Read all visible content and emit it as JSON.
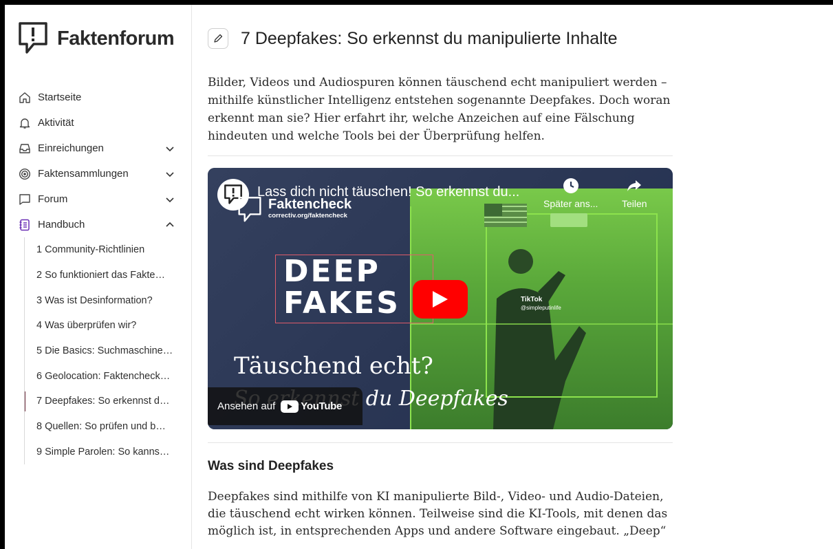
{
  "app": {
    "name": "Faktenforum"
  },
  "nav": {
    "items": [
      {
        "label": "Startseite",
        "icon": "home-icon",
        "expandable": false
      },
      {
        "label": "Aktivität",
        "icon": "bell-icon",
        "expandable": false
      },
      {
        "label": "Einreichungen",
        "icon": "inbox-icon",
        "expandable": true,
        "expanded": false
      },
      {
        "label": "Faktensammlungen",
        "icon": "target-icon",
        "expandable": true,
        "expanded": false
      },
      {
        "label": "Forum",
        "icon": "chat-bubble-icon",
        "expandable": true,
        "expanded": false
      },
      {
        "label": "Handbuch",
        "icon": "handbook-icon",
        "expandable": true,
        "expanded": true
      }
    ],
    "handbook_items": [
      "1 Community-Richtlinien",
      "2 So funktioniert das Fakte…",
      "3 Was ist Desinformation?",
      "4 Was überprüfen wir?",
      "5 Die Basics: Suchmaschine…",
      "6 Geolocation: Faktencheck…",
      "7 Deepfakes: So erkennst d…",
      "8 Quellen: So prüfen und b…",
      "9 Simple Parolen: So kanns…"
    ],
    "active_index": 6
  },
  "page": {
    "title": "7 Deepfakes: So erkennst du manipulierte Inhalte",
    "intro": "Bilder, Videos und Audiospuren können täuschend echt manipuliert werden – mithilfe künstlicher Intelligenz entstehen sogenannte Deepfakes. Doch woran erkennt man sie? Hier erfahrt ihr, welche Anzeichen auf eine Fälschung hindeuten und welche Tools bei der Überprüfung helfen.",
    "section_heading": "Was sind Deepfakes",
    "section_text": "Deepfakes sind mithilfe von KI manipulierte Bild-, Video- und Audio-Dateien, die täuschend echt wirken können. Teilweise sind die KI-Tools, mit denen das möglich ist, in entsprechenden Apps und andere Software eingebaut. „Deep“"
  },
  "video": {
    "title": "Lass dich nicht täuschen! So erkennst du...",
    "channel": "Faktencheck",
    "channel_url": "correctiv.org/faktencheck",
    "watch_later": "Später ans...",
    "share": "Teilen",
    "deep_line1": "DEEP",
    "deep_line2": "FAKES",
    "overlay_title": "Täuschend echt?",
    "overlay_subtitle": "So erkennst du Deepfakes",
    "watch_on": "Ansehen auf",
    "youtube": "YouTube",
    "tiktok_label": "TikTok",
    "tiktok_handle": "@simpleputinlife",
    "colors": {
      "accent_green": "#8de34d",
      "play_red": "#ff0000",
      "frame_red": "#e05c6a"
    }
  }
}
